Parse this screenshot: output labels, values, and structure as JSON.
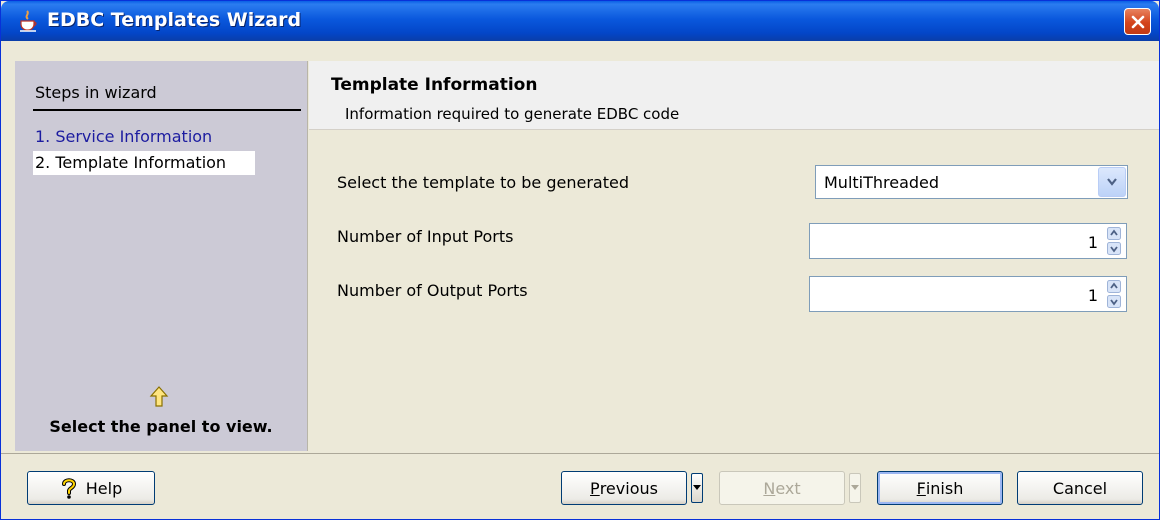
{
  "window": {
    "title": "EDBC Templates Wizard"
  },
  "sidebar": {
    "title": "Steps in wizard",
    "steps": [
      {
        "label": "1. Service Information",
        "state": "visited"
      },
      {
        "label": "2. Template Information",
        "state": "current"
      }
    ],
    "hint": "Select the panel to view."
  },
  "header": {
    "title": "Template Information",
    "subtitle": "Information required to generate EDBC code"
  },
  "form": {
    "template_label": "Select the template to be generated",
    "template_value": "MultiThreaded",
    "input_ports_label": "Number of Input Ports",
    "input_ports_value": "1",
    "output_ports_label": "Number of Output Ports",
    "output_ports_value": "1"
  },
  "footer": {
    "help": "Help",
    "previous_u": "P",
    "previous_rest": "revious",
    "next_u": "N",
    "next_rest": "ext",
    "finish_u": "F",
    "finish_rest": "inish",
    "cancel": "Cancel"
  },
  "colors": {
    "titlebar": "#0a58dd",
    "sidebar": "#cccad6",
    "close": "#d4451d"
  },
  "icons": [
    "java-cup-icon",
    "close-icon",
    "up-arrow-icon",
    "chevron-down-icon",
    "spin-up-icon",
    "spin-down-icon",
    "help-icon",
    "split-arrow-icon"
  ]
}
